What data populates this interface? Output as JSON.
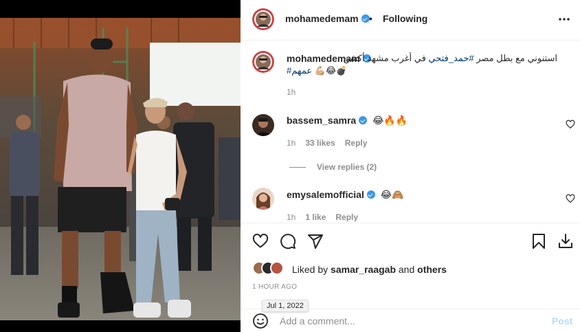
{
  "post": {
    "photo_alt": "",
    "author": "mohamedemam",
    "separator": "•",
    "follow_status": "Following"
  },
  "caption": {
    "username": "mohamedemam",
    "text_arabic": "استنوني مع بطل مصر ",
    "hashtag1": "#حمد_فتحي",
    "text_arabic2": " في أغرب مشهد أكشن",
    "hashtag2": "#عمهم",
    "emojis": "💪🏼😂💣",
    "time": "1h"
  },
  "comments": [
    {
      "username": "bassem_samra",
      "text": "😂🔥🔥",
      "time": "1h",
      "likes": "33 likes",
      "reply_label": "Reply",
      "view_replies": "View replies (2)"
    },
    {
      "username": "emysalemofficial",
      "text": "😂🙈",
      "time": "1h",
      "likes": "1 like",
      "reply_label": "Reply"
    }
  ],
  "likes": {
    "prefix": "Liked by",
    "user": "samar_raagab",
    "and": "and",
    "others": "others"
  },
  "post_time": "1 HOUR AGO",
  "tooltip_date": "Jul 1, 2022",
  "comment_box": {
    "placeholder": "Add a comment...",
    "post_label": "Post"
  },
  "icons": {
    "more": "more-icon",
    "like": "heart-icon",
    "comment": "comment-icon",
    "share": "paper-plane-icon",
    "save": "bookmark-icon",
    "download": "download-icon",
    "emoji": "smiley-icon"
  },
  "colors": {
    "verified": "#3897f0",
    "hashtag": "#00376b",
    "muted": "#8e8e8e",
    "post_button": "#b2dffc"
  }
}
